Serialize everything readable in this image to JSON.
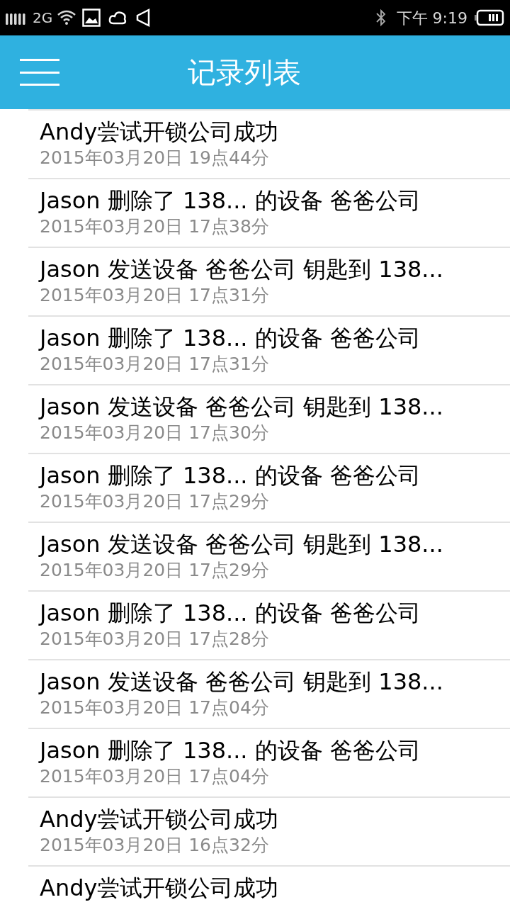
{
  "status_bar": {
    "network": "2G",
    "time": "下午 9:19"
  },
  "header": {
    "title": "记录列表"
  },
  "records": [
    {
      "title": "Andy尝试开锁公司成功",
      "date": "2015年03月20日 19点44分"
    },
    {
      "title": "Jason 删除了 138... 的设备 爸爸公司",
      "date": "2015年03月20日 17点38分"
    },
    {
      "title": "Jason 发送设备 爸爸公司 钥匙到 138...",
      "date": "2015年03月20日 17点31分"
    },
    {
      "title": "Jason 删除了 138... 的设备 爸爸公司",
      "date": "2015年03月20日 17点31分"
    },
    {
      "title": "Jason 发送设备 爸爸公司 钥匙到 138...",
      "date": "2015年03月20日 17点30分"
    },
    {
      "title": "Jason 删除了 138... 的设备 爸爸公司",
      "date": "2015年03月20日 17点29分"
    },
    {
      "title": "Jason 发送设备 爸爸公司 钥匙到 138...",
      "date": "2015年03月20日 17点29分"
    },
    {
      "title": "Jason 删除了 138... 的设备 爸爸公司",
      "date": "2015年03月20日 17点28分"
    },
    {
      "title": "Jason 发送设备 爸爸公司 钥匙到 138...",
      "date": "2015年03月20日 17点04分"
    },
    {
      "title": "Jason 删除了 138... 的设备 爸爸公司",
      "date": "2015年03月20日 17点04分"
    },
    {
      "title": "Andy尝试开锁公司成功",
      "date": "2015年03月20日 16点32分"
    },
    {
      "title": "Andy尝试开锁公司成功"
    }
  ]
}
